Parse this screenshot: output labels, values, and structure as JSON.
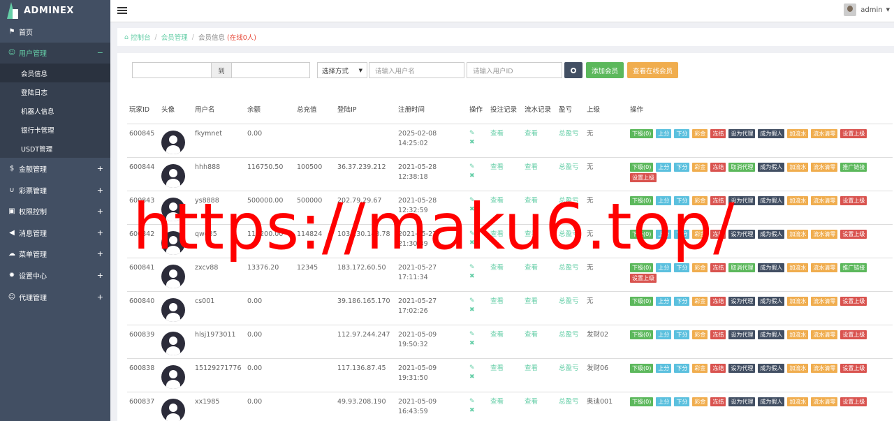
{
  "app": {
    "logo_text": "ADMINEX",
    "user": "admin"
  },
  "sidebar": {
    "items": [
      {
        "label": "首页",
        "icon": "flag-icon",
        "glyph": "⚑",
        "sign": ""
      },
      {
        "label": "用户管理",
        "icon": "smile-icon",
        "glyph": "☺",
        "sign": "−"
      },
      {
        "label": "金额管理",
        "icon": "dollar-icon",
        "glyph": "$",
        "sign": "+"
      },
      {
        "label": "彩票管理",
        "icon": "magnet-icon",
        "glyph": "∪",
        "sign": "+"
      },
      {
        "label": "权限控制",
        "icon": "lock-icon",
        "glyph": "▣",
        "sign": "+"
      },
      {
        "label": "消息管理",
        "icon": "bullhorn-icon",
        "glyph": "◀",
        "sign": "+"
      },
      {
        "label": "菜单管理",
        "icon": "cloud-icon",
        "glyph": "☁",
        "sign": "+"
      },
      {
        "label": "设置中心",
        "icon": "gear-icon",
        "glyph": "✹",
        "sign": "+"
      },
      {
        "label": "代理管理",
        "icon": "smile-icon",
        "glyph": "☺",
        "sign": "+"
      }
    ],
    "subitems": [
      "会员信息",
      "登陆日志",
      "机器人信息",
      "银行卡管理",
      "USDT管理"
    ]
  },
  "breadcrumb": {
    "home": "控制台",
    "section": "会员管理",
    "current": "会员信息",
    "online": "(在线0人)"
  },
  "filters": {
    "to_label": "到",
    "select_label": "选择方式",
    "username_placeholder": "请输入用户名",
    "userid_placeholder": "请输入用户ID",
    "add_member": "添加会员",
    "view_online": "查看在线会员"
  },
  "table": {
    "headers": [
      "玩家ID",
      "头像",
      "用户名",
      "余额",
      "总充值",
      "登陆IP",
      "注册时间",
      "操作",
      "投注记录",
      "流水记录",
      "盈亏",
      "上级",
      "操作"
    ],
    "view_label": "查看",
    "profit_label": "总盈亏",
    "rows": [
      {
        "id": "600845",
        "user": "fkymnet",
        "balance": "0.00",
        "recharge": "",
        "ip": "",
        "date": "2025-02-08",
        "time": "14:25:02",
        "parent": "无",
        "down": "下级(0)",
        "agent": "设为代理",
        "extra": ""
      },
      {
        "id": "600844",
        "user": "hhh888",
        "balance": "116750.50",
        "recharge": "100500",
        "ip": "36.37.239.212",
        "date": "2021-05-28",
        "time": "12:38:18",
        "parent": "无",
        "down": "下级(0)",
        "agent": "取消代理",
        "extra": "推广链接"
      },
      {
        "id": "600843",
        "user": "ys8888",
        "balance": "500000.00",
        "recharge": "500000",
        "ip": "202.79.29.67",
        "date": "2021-05-28",
        "time": "12:32:59",
        "parent": "无",
        "down": "下级(0)",
        "agent": "设为代理",
        "extra": ""
      },
      {
        "id": "600842",
        "user": "qwe35",
        "balance": "115200.00",
        "recharge": "114824",
        "ip": "103.130.143.78",
        "date": "2021-05-27",
        "time": "21:30:39",
        "parent": "无",
        "down": "下级(0)",
        "agent": "设为代理",
        "extra": ""
      },
      {
        "id": "600841",
        "user": "zxcv88",
        "balance": "13376.20",
        "recharge": "12345",
        "ip": "183.172.60.50",
        "date": "2021-05-27",
        "time": "17:11:34",
        "parent": "无",
        "down": "下级(0)",
        "agent": "取消代理",
        "extra": "推广链接"
      },
      {
        "id": "600840",
        "user": "cs001",
        "balance": "0.00",
        "recharge": "",
        "ip": "39.186.165.170",
        "date": "2021-05-27",
        "time": "17:02:26",
        "parent": "无",
        "down": "下级(0)",
        "agent": "设为代理",
        "extra": ""
      },
      {
        "id": "600839",
        "user": "hlsj1973011",
        "balance": "0.00",
        "recharge": "",
        "ip": "112.97.244.247",
        "date": "2021-05-09",
        "time": "19:50:32",
        "parent": "发财02",
        "down": "下级(0)",
        "agent": "设为代理",
        "extra": ""
      },
      {
        "id": "600838",
        "user": "15129271776",
        "balance": "0.00",
        "recharge": "",
        "ip": "117.136.87.45",
        "date": "2021-05-09",
        "time": "19:31:50",
        "parent": "发财06",
        "down": "下级(0)",
        "agent": "设为代理",
        "extra": ""
      },
      {
        "id": "600837",
        "user": "xx1985",
        "balance": "0.00",
        "recharge": "",
        "ip": "49.93.208.190",
        "date": "2021-05-09",
        "time": "16:43:59",
        "parent": "奥迪001",
        "down": "下级(0)",
        "agent": "设为代理",
        "extra": ""
      }
    ],
    "actions": {
      "up": "上分",
      "down_score": "下分",
      "bonus": "彩金",
      "freeze": "冻结",
      "fake": "成为假人",
      "add_flow": "加流水",
      "clear_flow": "流水清零",
      "set_parent": "设置上级"
    }
  },
  "watermark": "https://maku6.top/"
}
